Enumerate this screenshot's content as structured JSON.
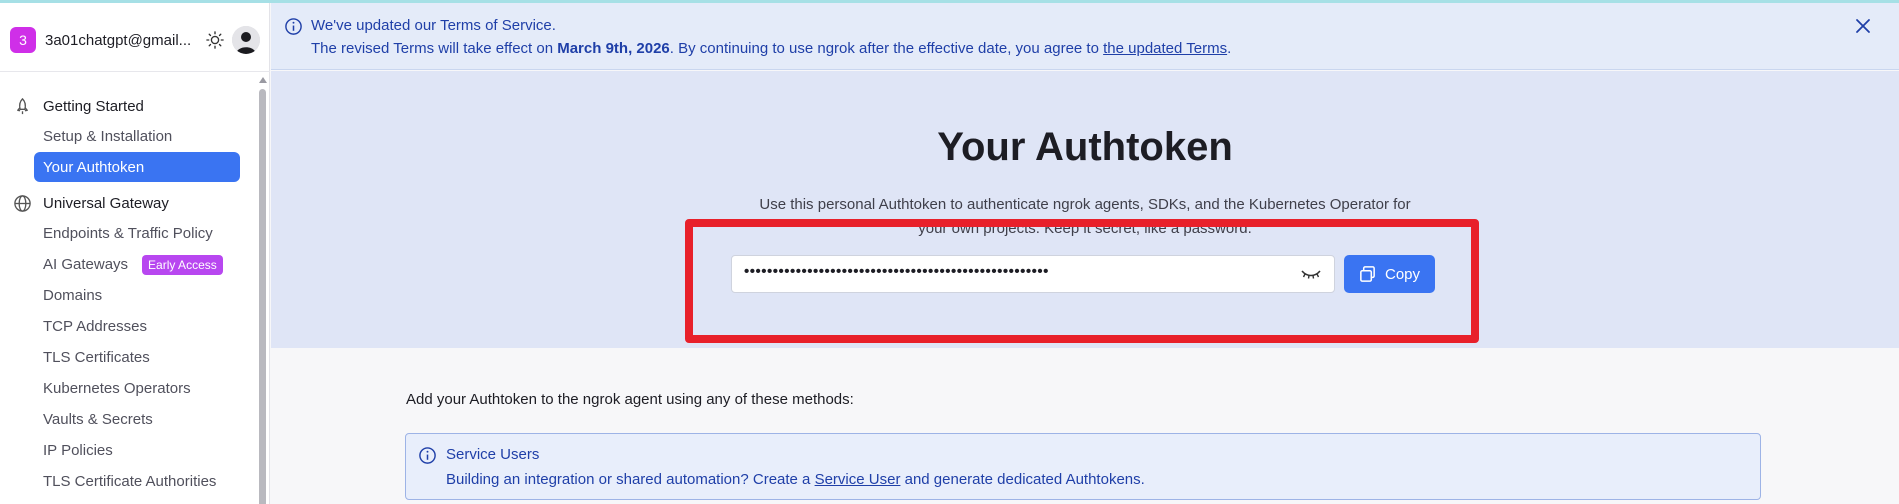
{
  "account": {
    "badge": "3",
    "email": "3a01chatgpt@gmail..."
  },
  "sidebar": {
    "sections": [
      {
        "label": "Getting Started",
        "icon": "rocket-icon",
        "items": [
          "Setup & Installation",
          "Your Authtoken"
        ],
        "active": "Your Authtoken"
      },
      {
        "label": "Universal Gateway",
        "icon": "globe-icon",
        "items": [
          "Endpoints & Traffic Policy",
          "AI Gateways",
          "Domains",
          "TCP Addresses",
          "TLS Certificates",
          "Kubernetes Operators",
          "Vaults & Secrets",
          "IP Policies",
          "TLS Certificate Authorities"
        ]
      }
    ],
    "ai_gateways_badge": "Early Access"
  },
  "banner": {
    "title": "We've updated our Terms of Service.",
    "text_before": "The revised Terms will take effect on ",
    "date": "March 9th, 2026",
    "text_after": ". By continuing to use ngrok after the effective date, you agree to ",
    "link": "the updated Terms",
    "end": "."
  },
  "hero": {
    "title": "Your Authtoken",
    "description_line1": "Use this personal Authtoken to authenticate ngrok agents, SDKs, and the Kubernetes Operator for",
    "description_line2": "your own projects. Keep it secret, like a password.",
    "token_masked": "•••••••••••••••••••••••••••••••••••••••••••••••••••••",
    "copy_label": "Copy"
  },
  "lower": {
    "intro": "Add your Authtoken to the ngrok agent using any of these methods:",
    "service_users": {
      "title": "Service Users",
      "text_before": "Building an integration or shared automation? Create a ",
      "link": "Service User",
      "text_after": " and generate dedicated Authtokens."
    }
  },
  "colors": {
    "accent": "#3a74f2",
    "highlight": "#e8202a",
    "banner_text": "#1f3fa8",
    "badge": "#cf2fe8"
  }
}
